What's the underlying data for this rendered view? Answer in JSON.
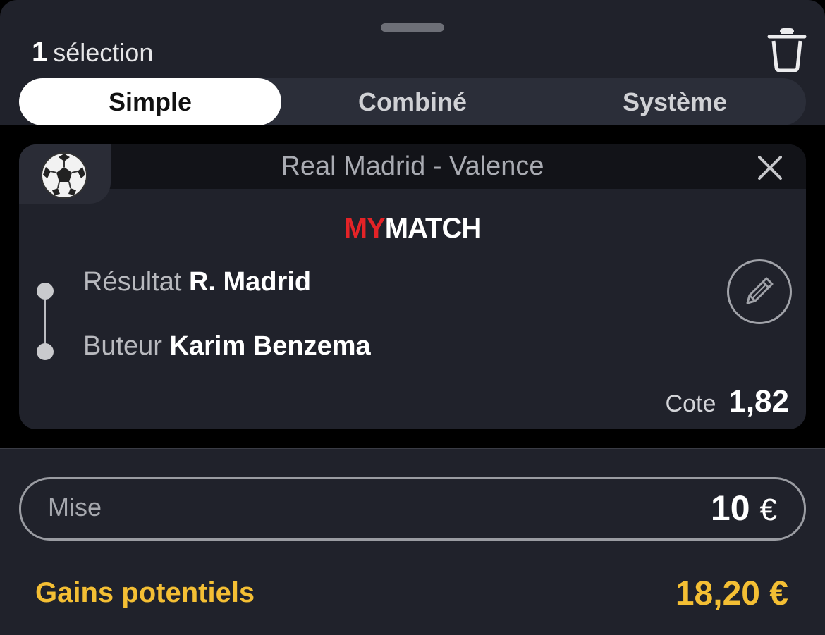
{
  "header": {
    "selection_count": "1",
    "selection_label": "sélection"
  },
  "tabs": [
    {
      "label": "Simple",
      "active": true
    },
    {
      "label": "Combiné",
      "active": false
    },
    {
      "label": "Système",
      "active": false
    }
  ],
  "bet": {
    "match_title": "Real Madrid - Valence",
    "brand_part1": "MY",
    "brand_part2": "MATCH",
    "selections": [
      {
        "market": "Résultat",
        "pick": "R. Madrid"
      },
      {
        "market": "Buteur",
        "pick": "Karim Benzema"
      }
    ],
    "odds_label": "Cote",
    "odds_value": "1,82"
  },
  "stake": {
    "label": "Mise",
    "amount": "10",
    "currency": "€"
  },
  "gains": {
    "label": "Gains potentiels",
    "value": "18,20 €"
  },
  "icons": {
    "trash": "trash-icon",
    "sport": "soccer-ball-icon",
    "close": "close-icon",
    "edit": "pencil-icon"
  },
  "colors": {
    "background": "#20222b",
    "accent_gold": "#f4bf34",
    "brand_red": "#e42327"
  }
}
